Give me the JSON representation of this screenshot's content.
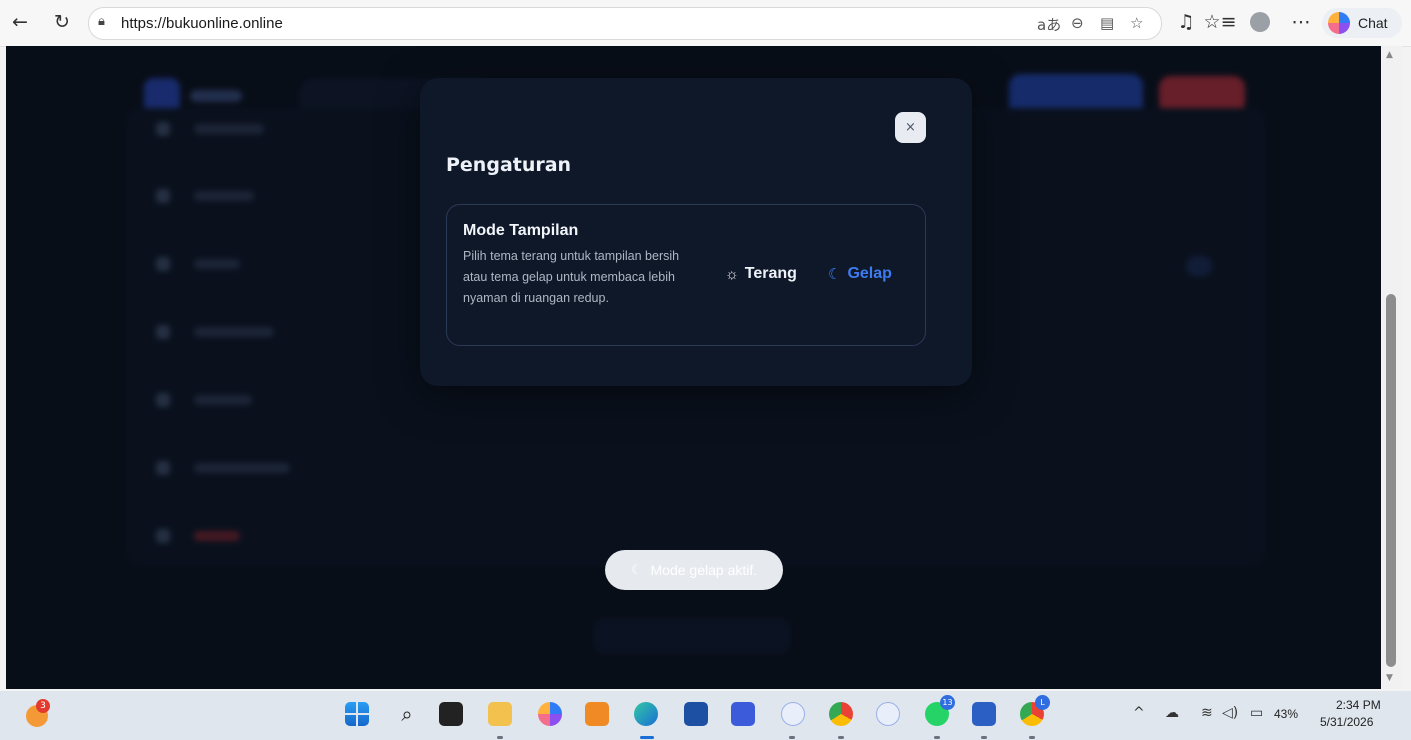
{
  "browser": {
    "url": "https://bukuonline.online",
    "chat_label": "Chat"
  },
  "modal": {
    "title": "Pengaturan",
    "close_label": "×",
    "card": {
      "title": "Mode Tampilan",
      "description": "Pilih tema terang untuk tampilan bersih atau tema gelap untuk membaca lebih nyaman di ruangan redup.",
      "options": [
        {
          "label": "Terang",
          "icon": "sun-icon",
          "selected": false
        },
        {
          "label": "Gelap",
          "icon": "moon-icon",
          "selected": true
        }
      ]
    }
  },
  "toast": {
    "text": "Mode gelap aktif.",
    "icon": "moon-icon"
  },
  "taskbar": {
    "weather_badge": "3",
    "whatsapp_badge": "13",
    "chrome_profile_badge": "L",
    "battery": "43%",
    "time": "2:34 PM",
    "date": "5/31/2026"
  },
  "colors": {
    "page_bg": "#0c1320",
    "modal_bg": "#0f1829",
    "accent": "#3d7bf0",
    "toast_bg": "#e6e9ee"
  }
}
